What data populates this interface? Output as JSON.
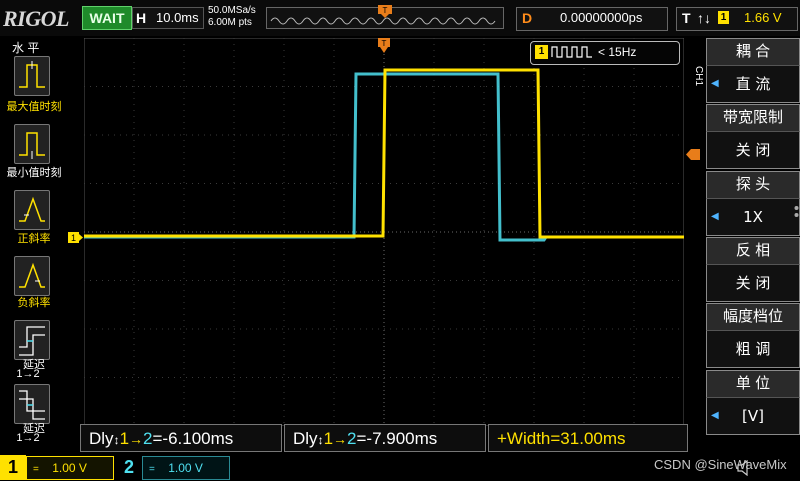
{
  "topbar": {
    "logo": "RIGOL",
    "status": "WAIT",
    "timebase_label": "H",
    "timebase_value": "10.0ms",
    "sample_rate": "50.0MSa/s",
    "memory_depth": "6.00M pts",
    "delay_label": "D",
    "delay_value": "0.00000000ps",
    "trigger_label": "T",
    "trigger_edge": "↑↓",
    "trigger_source": "1",
    "trigger_level": "1.66 V"
  },
  "left_menu": {
    "title": "水 平",
    "items": [
      {
        "label": "最大值时刻"
      },
      {
        "label": "最小值时刻"
      },
      {
        "label": "正斜率"
      },
      {
        "label": "负斜率"
      },
      {
        "label": "延迟",
        "sub": "1→2"
      },
      {
        "label": "延迟",
        "sub": "1→2"
      }
    ]
  },
  "counter": {
    "channel": "1",
    "frequency": "< 15Hz"
  },
  "right_menu": {
    "channel_tab": "CH1",
    "items": [
      {
        "title": "耦 合",
        "value": "直 流"
      },
      {
        "title": "带宽限制",
        "value": "关 闭"
      },
      {
        "title": "探 头",
        "value": "1X"
      },
      {
        "title": "反 相",
        "value": "关 闭"
      },
      {
        "title": "幅度档位",
        "value": "粗 调"
      },
      {
        "title": "单 位",
        "value": "[V]"
      }
    ]
  },
  "measurements": [
    {
      "prefix": "Dly",
      "edge": "↕",
      "a": "1",
      "arrow": "→",
      "b": "2",
      "value": "=-6.100ms"
    },
    {
      "prefix": "Dly",
      "edge": "↕",
      "a": "1",
      "arrow": "→",
      "b": "2",
      "value": "=-7.900ms"
    },
    {
      "text": "+Width=31.00ms"
    }
  ],
  "channels": [
    {
      "num": "1",
      "coupling": "=",
      "scale": "1.00 V",
      "color": "#ffe100"
    },
    {
      "num": "2",
      "coupling": "=",
      "scale": "1.00 V",
      "color": "#4fe0f0"
    }
  ],
  "markers": {
    "ch1_ground": "1",
    "trigger_pos": "T"
  },
  "watermark": "CSDN @SineWaveMix",
  "colors": {
    "ch1": "#ffe100",
    "ch2": "#4fe0f0",
    "accent": "#ff8c1a",
    "wait": "#1f8a2a"
  }
}
